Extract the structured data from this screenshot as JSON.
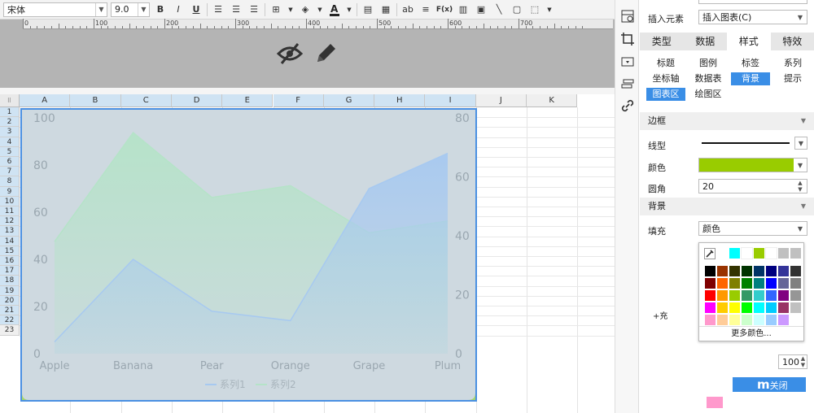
{
  "toolbar": {
    "font_family": "宋体",
    "font_size": "9.0",
    "bold": "B",
    "italic": "I",
    "underline": "U",
    "text_tool": "ab",
    "formula": "F(x)"
  },
  "ruler": {
    "marks": [
      "0",
      "100",
      "200",
      "300",
      "400",
      "500",
      "600",
      "700"
    ]
  },
  "grid": {
    "columns": [
      "A",
      "B",
      "C",
      "D",
      "E",
      "F",
      "G",
      "H",
      "I",
      "J",
      "K"
    ],
    "rows": [
      "1",
      "2",
      "3",
      "4",
      "5",
      "6",
      "7",
      "8",
      "9",
      "10",
      "11",
      "12",
      "13",
      "14",
      "15",
      "16",
      "17",
      "18",
      "19",
      "20",
      "21",
      "22",
      "23"
    ]
  },
  "chart_data": {
    "type": "area",
    "categories": [
      "Apple",
      "Banana",
      "Pear",
      "Orange",
      "Grape",
      "Plum"
    ],
    "series": [
      {
        "name": "系列1",
        "axis": "left",
        "values": [
          5,
          40,
          18,
          14,
          70,
          85
        ],
        "color": "#a7c9f0"
      },
      {
        "name": "系列2",
        "axis": "right",
        "values": [
          38,
          75,
          53,
          57,
          41,
          45
        ],
        "color": "#b5e3c8"
      }
    ],
    "left_axis": {
      "ticks": [
        "0",
        "20",
        "40",
        "60",
        "80",
        "100"
      ],
      "ylim": [
        0,
        100
      ]
    },
    "right_axis": {
      "ticks": [
        "0",
        "20",
        "40",
        "60",
        "80"
      ],
      "ylim": [
        0,
        80
      ]
    },
    "legend_position": "bottom",
    "grid": false,
    "background": "#ced9e0",
    "border_color": "#4a90e2"
  },
  "panel": {
    "insert_element_label": "插入元素",
    "insert_element_value": "插入图表(C)",
    "main_tabs": [
      "类型",
      "数据",
      "样式",
      "特效"
    ],
    "active_main_tab": "样式",
    "sub_tabs": [
      "标题",
      "图例",
      "标签",
      "系列",
      "坐标轴",
      "数据表",
      "背景",
      "提示",
      "图表区",
      "绘图区"
    ],
    "active_sub_tabs": [
      "背景",
      "图表区"
    ],
    "section_border": "边框",
    "line_type_label": "线型",
    "color_label": "颜色",
    "border_color": "#99cc00",
    "radius_label": "圆角",
    "radius_value": "20",
    "section_background": "背景",
    "fill_label": "填充",
    "fill_value": "颜色",
    "more_colors": "更多颜色...",
    "partial_label": "充",
    "opacity_value": "100",
    "off_label": "关闭",
    "partial_off_prefix": "m"
  },
  "palette": {
    "recent": [
      "#00ffff",
      "#ffffff",
      "#99cc00",
      "#ffffff",
      "#c0c0c0",
      "#c0c0c0"
    ],
    "rows": [
      [
        "#000000",
        "#993300",
        "#333300",
        "#003300",
        "#003366",
        "#000080",
        "#333399",
        "#333333"
      ],
      [
        "#800000",
        "#ff6600",
        "#808000",
        "#008000",
        "#008080",
        "#0000ff",
        "#666699",
        "#808080"
      ],
      [
        "#ff0000",
        "#ff9900",
        "#99cc00",
        "#339966",
        "#33cccc",
        "#3366ff",
        "#800080",
        "#969696"
      ],
      [
        "#ff00ff",
        "#ffcc00",
        "#ffff00",
        "#00ff00",
        "#00ffff",
        "#00ccff",
        "#993366",
        "#c0c0c0"
      ],
      [
        "#ff99cc",
        "#ffcc99",
        "#ffff99",
        "#ccffcc",
        "#ccffff",
        "#99ccff",
        "#cc99ff",
        "#ffffff"
      ]
    ]
  }
}
